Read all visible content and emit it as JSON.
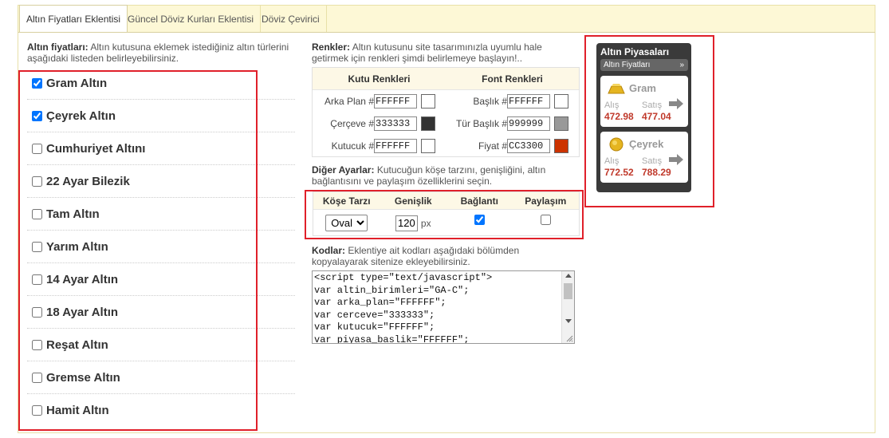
{
  "tabs": [
    {
      "label": "Altın Fiyatları Eklentisi"
    },
    {
      "label": "Güncel Döviz Kurları Eklentisi"
    },
    {
      "label": "Döviz Çevirici"
    }
  ],
  "left": {
    "intro_bold": "Altın fiyatları:",
    "intro_text": " Altın kutusuna eklemek istediğiniz altın türlerini aşağıdaki listeden belirleyebilirsiniz.",
    "items": [
      {
        "label": "Gram Altın",
        "checked": true
      },
      {
        "label": "Çeyrek Altın",
        "checked": true
      },
      {
        "label": "Cumhuriyet Altını",
        "checked": false
      },
      {
        "label": "22 Ayar Bilezik",
        "checked": false
      },
      {
        "label": "Tam Altın",
        "checked": false
      },
      {
        "label": "Yarım Altın",
        "checked": false
      },
      {
        "label": "14 Ayar Altın",
        "checked": false
      },
      {
        "label": "18 Ayar Altın",
        "checked": false
      },
      {
        "label": "Reşat Altın",
        "checked": false
      },
      {
        "label": "Gremse Altın",
        "checked": false
      },
      {
        "label": "Hamit Altın",
        "checked": false
      }
    ]
  },
  "colors": {
    "heading_bold": "Renkler:",
    "heading_text": " Altın kutusunu site tasarımınızla uyumlu hale getirmek için renkleri şimdi belirlemeye başlayın!..",
    "col_box": "Kutu Renkleri",
    "col_font": "Font Renkleri",
    "box_rows": [
      {
        "label": "Arka Plan #",
        "value": "FFFFFF",
        "swatch": "#FFFFFF"
      },
      {
        "label": "Çerçeve #",
        "value": "333333",
        "swatch": "#333333"
      },
      {
        "label": "Kutucuk #",
        "value": "FFFFFF",
        "swatch": "#FFFFFF"
      }
    ],
    "font_rows": [
      {
        "label": "Başlık #",
        "value": "FFFFFF",
        "swatch": "#FFFFFF"
      },
      {
        "label": "Tür Başlık #",
        "value": "999999",
        "swatch": "#999999"
      },
      {
        "label": "Fiyat #",
        "value": "CC3300",
        "swatch": "#CC3300"
      }
    ]
  },
  "other": {
    "heading_bold": "Diğer Ayarlar:",
    "heading_text": " Kutucuğun köşe tarzını, genişliğini, altın bağlantısını ve paylaşım özelliklerini seçin.",
    "headers": [
      "Köşe Tarzı",
      "Genişlik",
      "Bağlantı",
      "Paylaşım"
    ],
    "corner_value": "Oval",
    "width_value": "120",
    "width_unit": "px",
    "link_checked": true,
    "share_checked": false
  },
  "codes": {
    "heading_bold": "Kodlar:",
    "heading_text": " Eklentiye ait kodları aşağıdaki bölümden kopyalayarak sitenize ekleyebilirsiniz.",
    "lines": [
      "<script type=\"text/javascript\">",
      "var altin_birimleri=\"GA-C\";",
      "var arka_plan=\"FFFFFF\";",
      "var cerceve=\"333333\";",
      "var kutucuk=\"FFFFFF\";",
      "var piyasa_baslik=\"FFFFFF\";"
    ]
  },
  "widget": {
    "title": "Altın Piyasaları",
    "subtitle": "Altın Fiyatları",
    "subtitle_chevron": "»",
    "buy_label": "Alış",
    "sell_label": "Satış",
    "cards": [
      {
        "name": "Gram",
        "icon": "gold-bar-icon",
        "buy": "472.98",
        "sell": "477.04"
      },
      {
        "name": "Çeyrek",
        "icon": "gold-coin-icon",
        "buy": "772.52",
        "sell": "788.29"
      }
    ]
  },
  "accent_colors": {
    "highlight_red": "#e0202a",
    "tabbar_bg": "#fdf8d6",
    "price_red": "#c0392b"
  }
}
